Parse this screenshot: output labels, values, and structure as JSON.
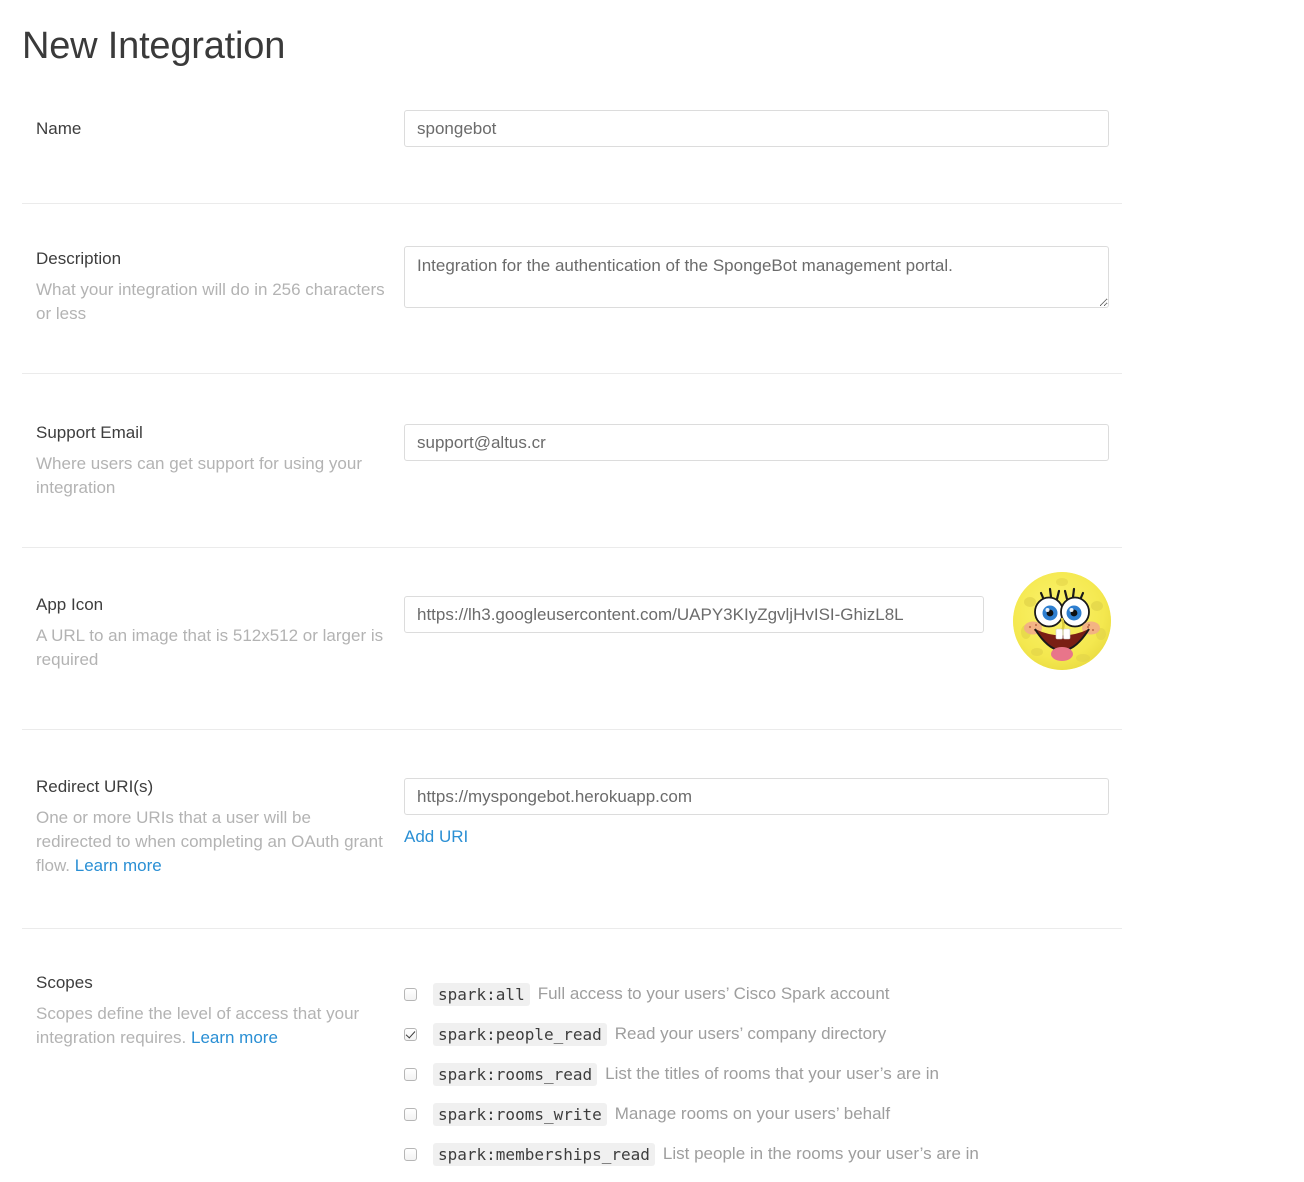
{
  "page": {
    "title": "New Integration"
  },
  "fields": {
    "name": {
      "label": "Name",
      "help": "",
      "value": "spongebot",
      "placeholder": ""
    },
    "description": {
      "label": "Description",
      "help": "What your integration will do in 256 characters or less",
      "value": "Integration for the authentication of the SpongeBot management portal.",
      "placeholder": ""
    },
    "support_email": {
      "label": "Support Email",
      "help": "Where users can get support for using your integration",
      "value": "support@altus.cr",
      "placeholder": ""
    },
    "app_icon": {
      "label": "App Icon",
      "help": "A URL to an image that is 512x512 or larger is required",
      "value": "https://lh3.googleusercontent.com/UAPY3KIyZgvljHvISI-GhizL8L",
      "placeholder": "",
      "avatar_name": "spongebob-avatar"
    },
    "redirect_uris": {
      "label": "Redirect URI(s)",
      "help_prefix": "One or more URIs that a user will be redirected to when completing an OAuth grant flow. ",
      "help_link": "Learn more",
      "value": "https://myspongebot.herokuapp.com",
      "placeholder": "",
      "add_link": "Add URI"
    },
    "scopes": {
      "label": "Scopes",
      "help_prefix": "Scopes define the level of access that your integration requires. ",
      "help_link": "Learn more",
      "items": [
        {
          "scope": "spark:all",
          "description": "Full access to your users’ Cisco Spark account",
          "checked": false
        },
        {
          "scope": "spark:people_read",
          "description": "Read your users’ company directory",
          "checked": true
        },
        {
          "scope": "spark:rooms_read",
          "description": "List the titles of rooms that your user’s are in",
          "checked": false
        },
        {
          "scope": "spark:rooms_write",
          "description": "Manage rooms on your users’ behalf",
          "checked": false
        },
        {
          "scope": "spark:memberships_read",
          "description": "List people in the rooms your user’s are in",
          "checked": false
        }
      ]
    }
  },
  "colors": {
    "link": "#2a8fd4",
    "label": "#3d3d3d",
    "help": "#b3b3b3",
    "border": "#dcdcdc",
    "divider": "#ebebeb"
  }
}
